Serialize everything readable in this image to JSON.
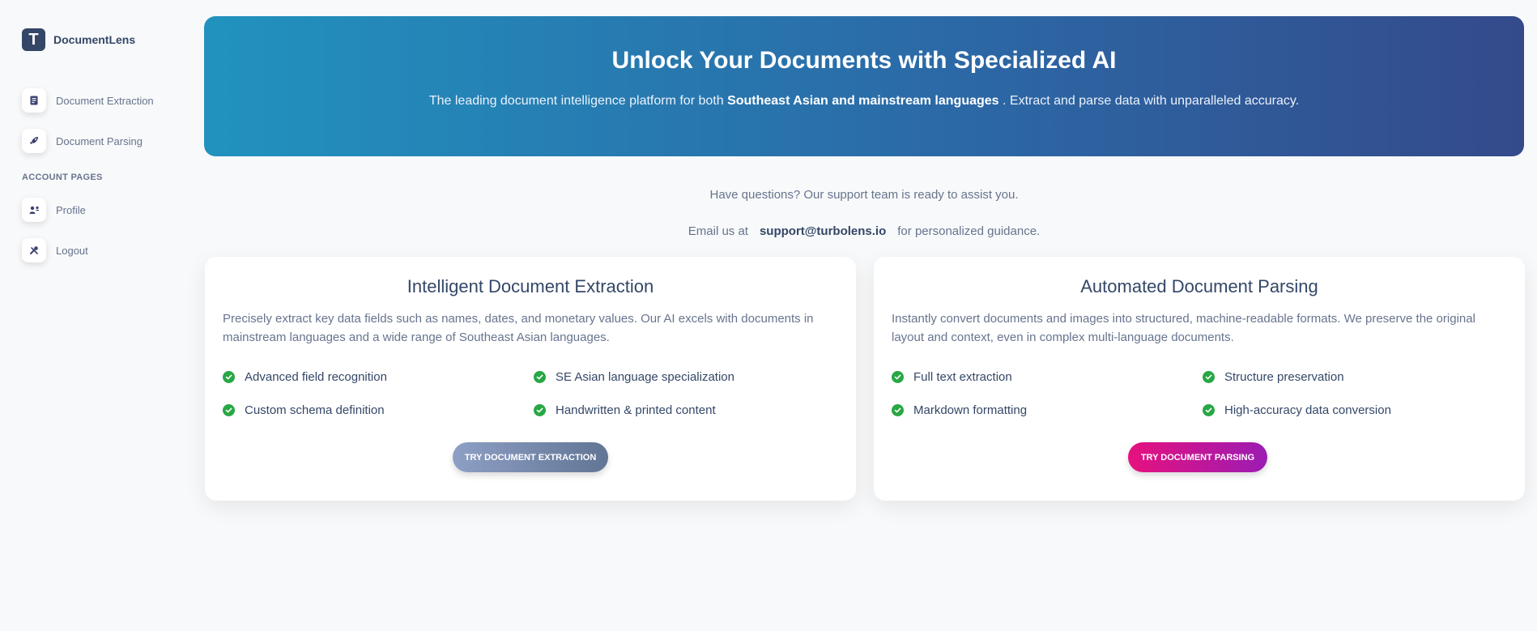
{
  "brand": {
    "logo_letter": "T",
    "name": "DocumentLens"
  },
  "sidebar": {
    "items": [
      {
        "label": "Document Extraction",
        "icon": "document-icon"
      },
      {
        "label": "Document Parsing",
        "icon": "rocket-icon"
      }
    ],
    "account_section_title": "ACCOUNT PAGES",
    "account_items": [
      {
        "label": "Profile",
        "icon": "user-icon"
      },
      {
        "label": "Logout",
        "icon": "tools-icon"
      }
    ]
  },
  "hero": {
    "title": "Unlock Your Documents with Specialized AI",
    "text_before": "The leading document intelligence platform for both ",
    "text_bold": "Southeast Asian and mainstream languages",
    "text_after": " . Extract and parse data with unparalleled accuracy."
  },
  "support": {
    "line1": "Have questions? Our support team is ready to assist you.",
    "prefix": "Email us at",
    "email": "support@turbolens.io",
    "suffix": "for personalized guidance."
  },
  "cards": [
    {
      "title": "Intelligent Document Extraction",
      "description": "Precisely extract key data fields such as names, dates, and monetary values. Our AI excels with documents in mainstream languages and a wide range of Southeast Asian languages.",
      "features": [
        "Advanced field recognition",
        "SE Asian language specialization",
        "Custom schema definition",
        "Handwritten & printed content"
      ],
      "button": "TRY DOCUMENT EXTRACTION"
    },
    {
      "title": "Automated Document Parsing",
      "description": "Instantly convert documents and images into structured, machine-readable formats. We preserve the original layout and context, even in complex multi-language documents.",
      "features": [
        "Full text extraction",
        "Structure preservation",
        "Markdown formatting",
        "High-accuracy data conversion"
      ],
      "button": "TRY DOCUMENT PARSING"
    }
  ],
  "colors": {
    "hero_gradient_start": "#2192be",
    "hero_gradient_end": "#344a8b",
    "check_green": "#28a745",
    "parse_button_start": "#e6117e",
    "parse_button_end": "#9b1cb3",
    "extract_button_start": "#8e9fc5",
    "extract_button_end": "#627594"
  }
}
